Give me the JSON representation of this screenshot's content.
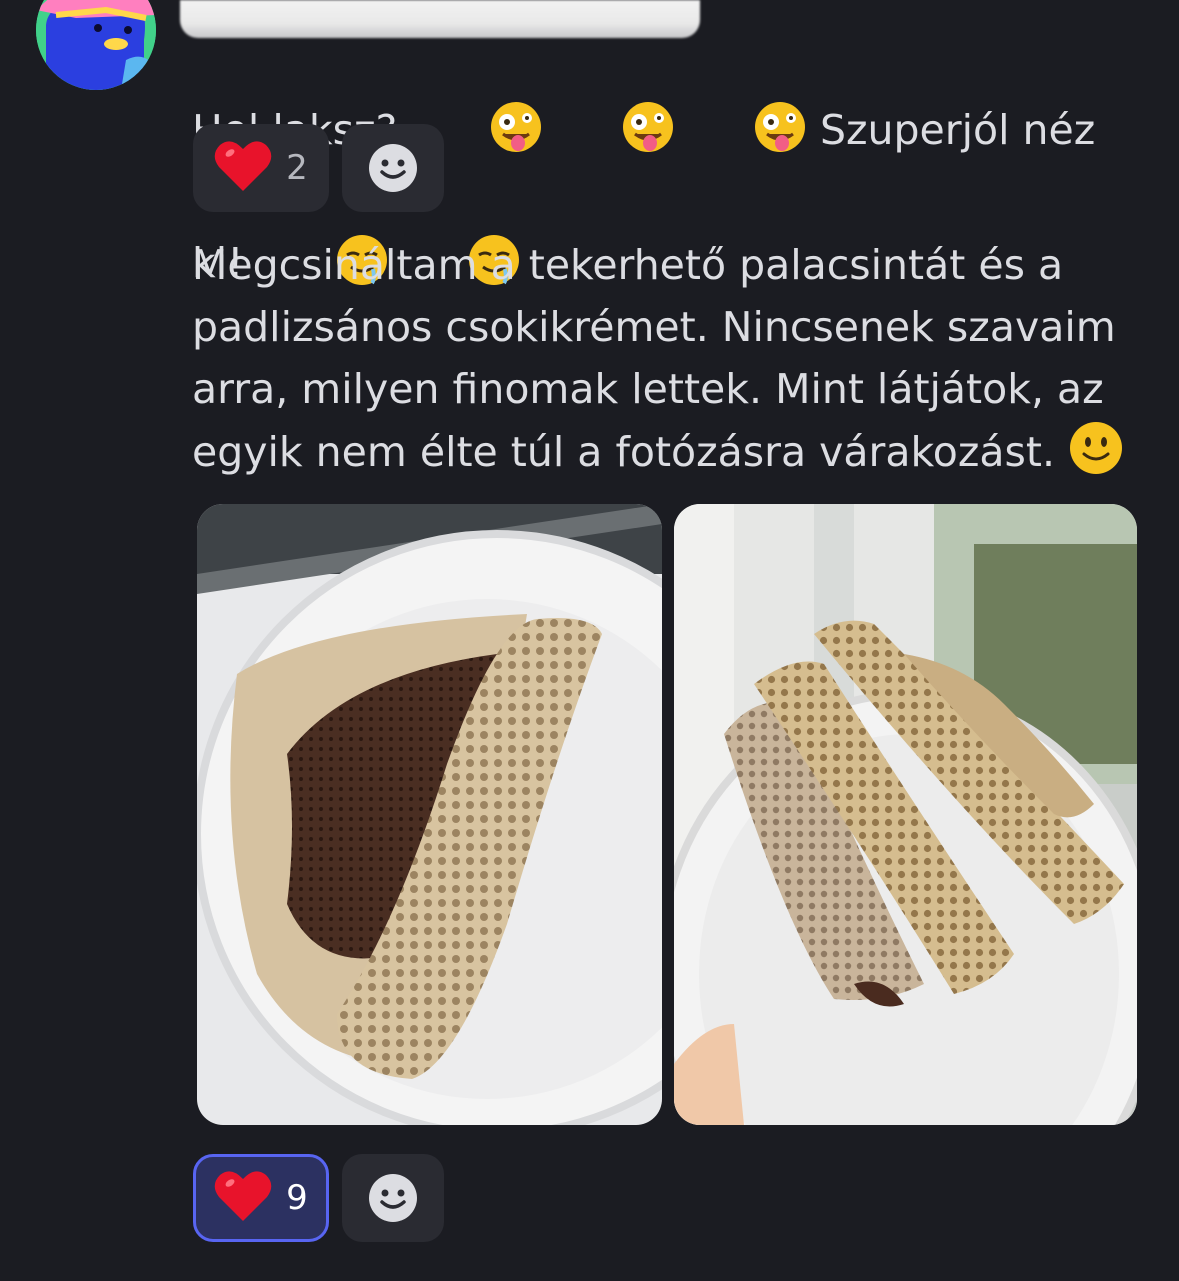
{
  "messages": [
    {
      "text": "Hol laksz?",
      "emojis_mid": "zany-face-emoji x3",
      "text_after": "Szuperjól néz ki!",
      "emojis_end": "drooling-face-emoji x2",
      "reactions": [
        {
          "icon": "red-heart-emoji",
          "count": "2",
          "active": false
        }
      ]
    },
    {
      "lines": [
        "Megcsináltam a tekerhető palacsintát és a",
        "padlizsános csokikrémet. Nincsenek szavaim",
        "arra, milyen finomak lettek. Mint látjátok, az",
        "egyik nem élte túl a fotózásra várakozást."
      ],
      "emoji_end": "slightly-smiling-face-emoji",
      "attachments": [
        {
          "icon": "photo-rolled-crepe-with-chocolate-spread"
        },
        {
          "icon": "photo-plate-of-rolled-crepes"
        }
      ],
      "reactions": [
        {
          "icon": "red-heart-emoji",
          "count": "9",
          "active": true
        }
      ]
    }
  ],
  "colors": {
    "background": "#1b1c22",
    "text": "#dcdde2",
    "reaction_bg": "#2a2b32",
    "reaction_active_bg": "#2c3161",
    "reaction_active_border": "#5865f2"
  }
}
